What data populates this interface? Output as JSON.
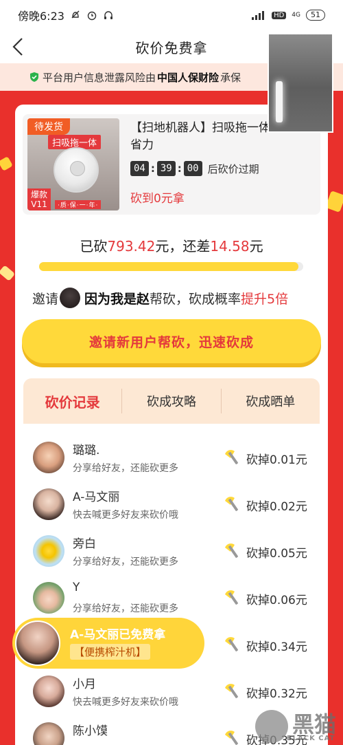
{
  "status_bar": {
    "time": "傍晚6:23",
    "network_label": "4G",
    "hd_label": "HD",
    "battery": "51"
  },
  "nav": {
    "title": "砍价免费拿"
  },
  "insurance": {
    "prefix": "平台用户信息泄露风险由",
    "insurer": "中国人保财险",
    "suffix": "承保"
  },
  "product": {
    "ship_tag": "待发货",
    "image_headline": "扫吸拖一体",
    "hot_tag": "爆款V11",
    "image_footer": "·质·保·一·年·",
    "title": "【扫地机器人】扫吸拖一体省心又省力",
    "countdown": {
      "hours": "04",
      "minutes": "39",
      "seconds": "00",
      "suffix": "后砍价过期"
    },
    "free_text": "砍到0元拿"
  },
  "progress": {
    "prefix": "已砍",
    "cut_amount": "793.42",
    "middle": "元，还差",
    "remain_amount": "14.58",
    "suffix": "元",
    "fraction": 0.982
  },
  "invite": {
    "prefix": "邀请",
    "friend_name": "因为我是赵",
    "middle": "帮砍，砍成概率",
    "boost": "提升5倍"
  },
  "cta": {
    "label": "邀请新用户帮砍，迅速砍成"
  },
  "tabs": [
    {
      "label": "砍价记录",
      "active": true
    },
    {
      "label": "砍成攻略",
      "active": false
    },
    {
      "label": "砍成晒单",
      "active": false
    }
  ],
  "records": [
    {
      "name": "璐璐.",
      "sub": "分享给好友，还能砍更多",
      "amount": "砍掉0.01元"
    },
    {
      "name": "A-马文丽",
      "sub": "快去喊更多好友来砍价哦",
      "amount": "砍掉0.02元"
    },
    {
      "name": "旁白",
      "sub": "分享给好友，还能砍更多",
      "amount": "砍掉0.05元"
    },
    {
      "name": "Y",
      "sub": "分享给好友，还能砍更多",
      "amount": "砍掉0.06元"
    },
    {
      "name": "",
      "sub": "",
      "amount": "砍掉0.34元"
    },
    {
      "name": "小月",
      "sub": "快去喊更多好友来砍价哦",
      "amount": "砍掉0.32元"
    },
    {
      "name": "陈小馍",
      "sub": "",
      "amount": "砍掉0.35元"
    }
  ],
  "toast": {
    "title": "A-马文丽已免费拿",
    "item": "【便携榨汁机】"
  },
  "watermark": {
    "brand": "黑猫",
    "sub": "BLACK CAT"
  },
  "colors": {
    "brand_red": "#e4393c",
    "cta_yellow": "#ffd93a",
    "background_red": "#e9302c"
  }
}
